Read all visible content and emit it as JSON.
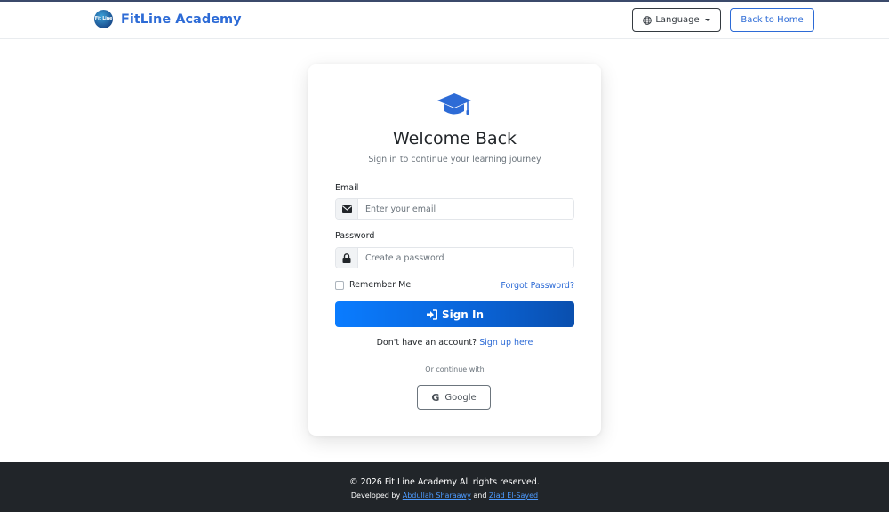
{
  "header": {
    "brand_name": "FitLine Academy",
    "logo_text": "Fit Line",
    "language_label": "Language",
    "back_home_label": "Back to Home"
  },
  "login": {
    "title": "Welcome Back",
    "subtitle": "Sign in to continue your learning journey",
    "email_label": "Email",
    "email_placeholder": "Enter your email",
    "email_value": "",
    "password_label": "Password",
    "password_placeholder": "Create a password",
    "password_value": "",
    "remember_label": "Remember Me",
    "remember_checked": false,
    "forgot_label": "Forgot Password?",
    "sign_in_label": "Sign In",
    "no_account_text": "Don't have an account?",
    "sign_up_label": "Sign up here",
    "or_continue": "Or continue with",
    "google_label": "Google"
  },
  "footer": {
    "copyright": "© 2026 Fit Line Academy All rights reserved.",
    "developed_by": "Developed by",
    "developer_1": "Abdullah Sharaawy",
    "and_text": "and",
    "developer_2": "Ziad El-Sayed"
  },
  "colors": {
    "accent": "#2d6bd6",
    "button_gradient_start": "#0a7cff",
    "button_gradient_end": "#0a4fae",
    "footer_bg": "#212529"
  },
  "icons": {
    "language": "globe-icon",
    "email": "envelope-icon",
    "password": "lock-icon",
    "sign_in": "sign-in-icon",
    "google": "google-icon",
    "title": "graduation-cap-icon"
  }
}
